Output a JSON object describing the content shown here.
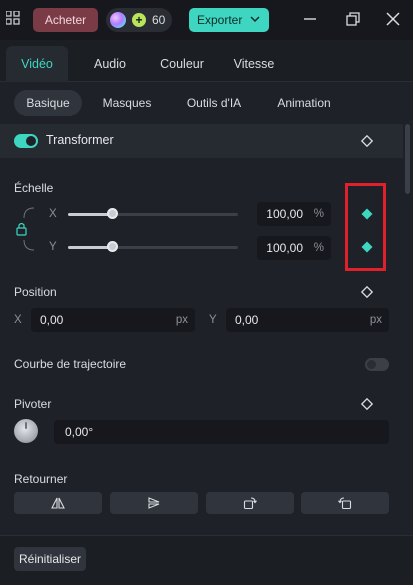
{
  "topbar": {
    "buy_label": "Acheter",
    "credits_count": "60",
    "export_label": "Exporter",
    "colors": {
      "export_bg": "#3ed6c1",
      "buy_bg": "#7a3b47"
    }
  },
  "tabs": [
    {
      "label": "Vidéo",
      "active": true
    },
    {
      "label": "Audio",
      "active": false
    },
    {
      "label": "Couleur",
      "active": false
    },
    {
      "label": "Vitesse",
      "active": false
    }
  ],
  "subtabs": [
    {
      "label": "Basique",
      "active": true
    },
    {
      "label": "Masques",
      "active": false
    },
    {
      "label": "Outils d'IA",
      "active": false
    },
    {
      "label": "Animation",
      "active": false
    }
  ],
  "transform": {
    "title": "Transformer",
    "enabled": true,
    "scale": {
      "label": "Échelle",
      "x": {
        "axis": "X",
        "value": "100,00",
        "unit": "%",
        "slider_fraction": 0.26
      },
      "y": {
        "axis": "Y",
        "value": "100,00",
        "unit": "%",
        "slider_fraction": 0.26
      }
    },
    "position": {
      "label": "Position",
      "x": {
        "axis": "X",
        "value": "0,00",
        "unit": "px"
      },
      "y": {
        "axis": "Y",
        "value": "0,00",
        "unit": "px"
      }
    },
    "trajectory": {
      "label": "Courbe de trajectoire",
      "enabled": false
    },
    "rotate": {
      "label": "Pivoter",
      "value": "0,00°"
    },
    "flip": {
      "label": "Retourner"
    }
  },
  "footer": {
    "reset_label": "Réinitialiser"
  },
  "accent_color": "#3ed6c1"
}
